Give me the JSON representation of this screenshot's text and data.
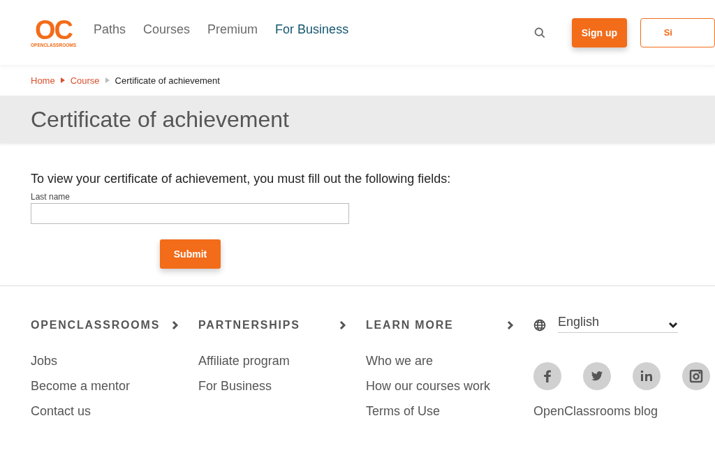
{
  "header": {
    "logo": {
      "mark": "OC",
      "wordmark": "OPENCLASSROOMS"
    },
    "nav": [
      {
        "label": "Paths",
        "selected": false
      },
      {
        "label": "Courses",
        "selected": false
      },
      {
        "label": "Premium",
        "selected": false
      },
      {
        "label": "For Business",
        "selected": true
      }
    ],
    "signup_button": "Sign up",
    "signin_button": "Si"
  },
  "breadcrumb": [
    {
      "label": "Home",
      "link": true
    },
    {
      "label": "Course",
      "link": true
    },
    {
      "label": "Certificate of achievement",
      "link": false
    }
  ],
  "title": "Certificate of achievement",
  "form": {
    "intro": "To view your certificate of achievement, you must fill out the following fields:",
    "field_label": "Last name",
    "submit": "Submit"
  },
  "footer": {
    "columns": [
      {
        "heading": "OPENCLASSROOMS",
        "links": [
          "Jobs",
          "Become a mentor",
          "Contact us"
        ]
      },
      {
        "heading": "PARTNERSHIPS",
        "links": [
          "Affiliate program",
          "For Business"
        ]
      },
      {
        "heading": "LEARN MORE",
        "links": [
          "Who we are",
          "How our courses work",
          "Terms of Use"
        ]
      }
    ],
    "language": "English",
    "socials": [
      {
        "kind": "facebook"
      },
      {
        "kind": "twitter"
      },
      {
        "kind": "linkedin"
      },
      {
        "kind": "instagram"
      }
    ],
    "blog": "OpenClassrooms blog"
  }
}
